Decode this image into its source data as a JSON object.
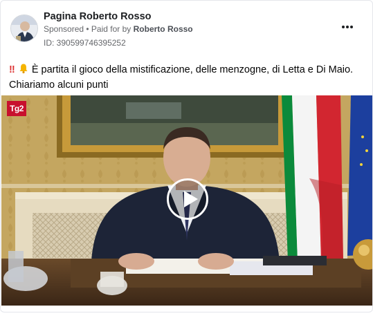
{
  "post": {
    "page_name": "Pagina Roberto Rosso",
    "sponsored_label": "Sponsored",
    "separator": " • ",
    "paid_for_label": "Paid for by ",
    "paid_for_name": "Roberto Rosso",
    "ad_id": "ID: 390599746395252",
    "caption_prefix": "‼",
    "caption_text": "È partita il gioco della mistificazione, delle menzogne, di Letta e Di Maio. Chiariamo alcuni punti",
    "more_icon": "more-horizontal-icon",
    "bell_icon": "bell-emoji"
  },
  "video": {
    "channel_logo": "Tg2",
    "play_icon": "play-icon",
    "colors": {
      "wall": "#c6aa63",
      "flag_green": "#0b8a3b",
      "flag_white": "#f4f4f4",
      "flag_red": "#d22630",
      "eu_blue": "#1c3f9e",
      "logo_red": "#c8102e"
    }
  }
}
